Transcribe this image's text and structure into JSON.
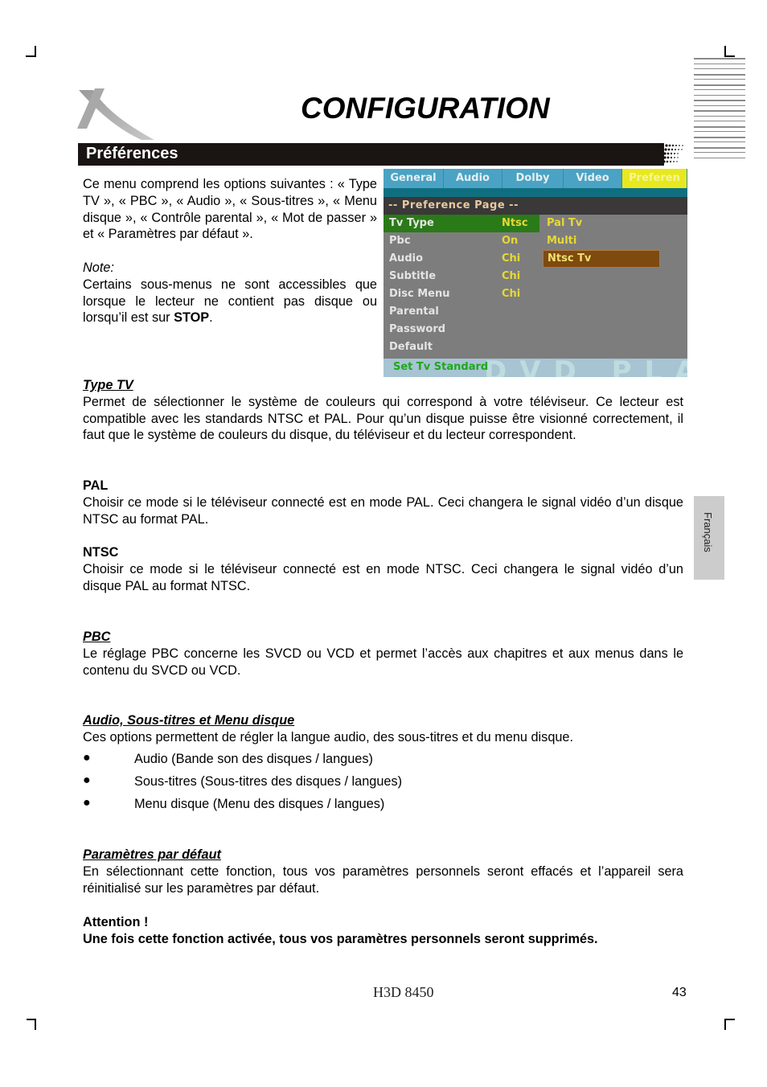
{
  "header": {
    "title": "CONFIGURATION",
    "logo_icon": "x-brand-logo",
    "section_title": "Préférences"
  },
  "intro": {
    "paragraph": "Ce menu comprend les options suivantes : « Type TV », « PBC », « Audio », « Sous-titres », « Menu disque », « Contrôle parental », « Mot de passer » et « Paramètres par défaut ».",
    "note_label": "Note:",
    "note_text": "Certains sous-menus ne sont accessibles que lorsque le lecteur ne contient pas disque ou lorsqu’il est sur ",
    "note_bold": "STOP",
    "note_end": "."
  },
  "osd": {
    "tabs": [
      "General",
      "Audio",
      "Dolby",
      "Video",
      "Preferen"
    ],
    "active_tab": "Preferen",
    "page_title": "-- Preference Page --",
    "rows": [
      {
        "label": "Tv Type",
        "value": "Ntsc",
        "selected": true
      },
      {
        "label": "Pbc",
        "value": "On"
      },
      {
        "label": "Audio",
        "value": "Chi"
      },
      {
        "label": "Subtitle",
        "value": "Chi"
      },
      {
        "label": "Disc Menu",
        "value": "Chi"
      },
      {
        "label": "Parental",
        "value": ""
      },
      {
        "label": "Password",
        "value": ""
      },
      {
        "label": "Default",
        "value": ""
      }
    ],
    "options": [
      "Pal Tv",
      "Multi",
      "Ntsc Tv"
    ],
    "selected_option": "Ntsc Tv",
    "status_hint": "Set Tv Standard",
    "background_brand": "DVD PLAYER",
    "colors": {
      "tab_bar": "#4aa3c4",
      "active_tab": "#e8e81e",
      "selected_row": "#2a7a18",
      "selected_option": "#7e4a10",
      "value_text": "#e6d836",
      "hint_text": "#1ea81e"
    }
  },
  "sections": {
    "type_tv": {
      "heading": "Type TV",
      "text": "Permet de sélectionner le système de couleurs qui correspond à votre téléviseur. Ce lecteur est compatible avec les standards NTSC et PAL.  Pour qu’un disque puisse être visionné correctement, il faut que le système de couleurs du disque, du téléviseur et du lecteur correspondent."
    },
    "pal": {
      "heading": "PAL",
      "text": "Choisir ce mode si le téléviseur connecté est en mode PAL. Ceci changera le signal vidéo d’un disque NTSC au format PAL."
    },
    "ntsc": {
      "heading": "NTSC",
      "text": "Choisir ce mode si le téléviseur connecté est en mode NTSC. Ceci changera le signal vidéo d’un disque PAL au format NTSC."
    },
    "pbc": {
      "heading": "PBC",
      "text": "Le réglage PBC concerne les SVCD ou VCD et permet l’accès aux chapitres et aux menus dans le contenu du SVCD ou VCD."
    },
    "audio": {
      "heading": "Audio, Sous-titres et Menu disque",
      "text": "Ces options permettent de régler la langue audio, des sous-titres et du menu disque.",
      "bullets": [
        "Audio (Bande son des disques / langues)",
        "Sous-titres (Sous-titres des disques / langues)",
        "Menu disque (Menu des disques / langues)"
      ]
    },
    "defaults": {
      "heading": "Paramètres par défaut",
      "text": "En sélectionnant cette fonction, tous vos paramètres personnels seront effacés et l’appareil sera réinitialisé sur les paramètres par défaut."
    },
    "attention": {
      "heading": "Attention !",
      "text": "Une fois cette fonction activée, tous vos paramètres personnels seront supprimés."
    }
  },
  "sidebar": {
    "language_tab": "Français"
  },
  "footer": {
    "model": "H3D 8450",
    "page_number": "43"
  }
}
